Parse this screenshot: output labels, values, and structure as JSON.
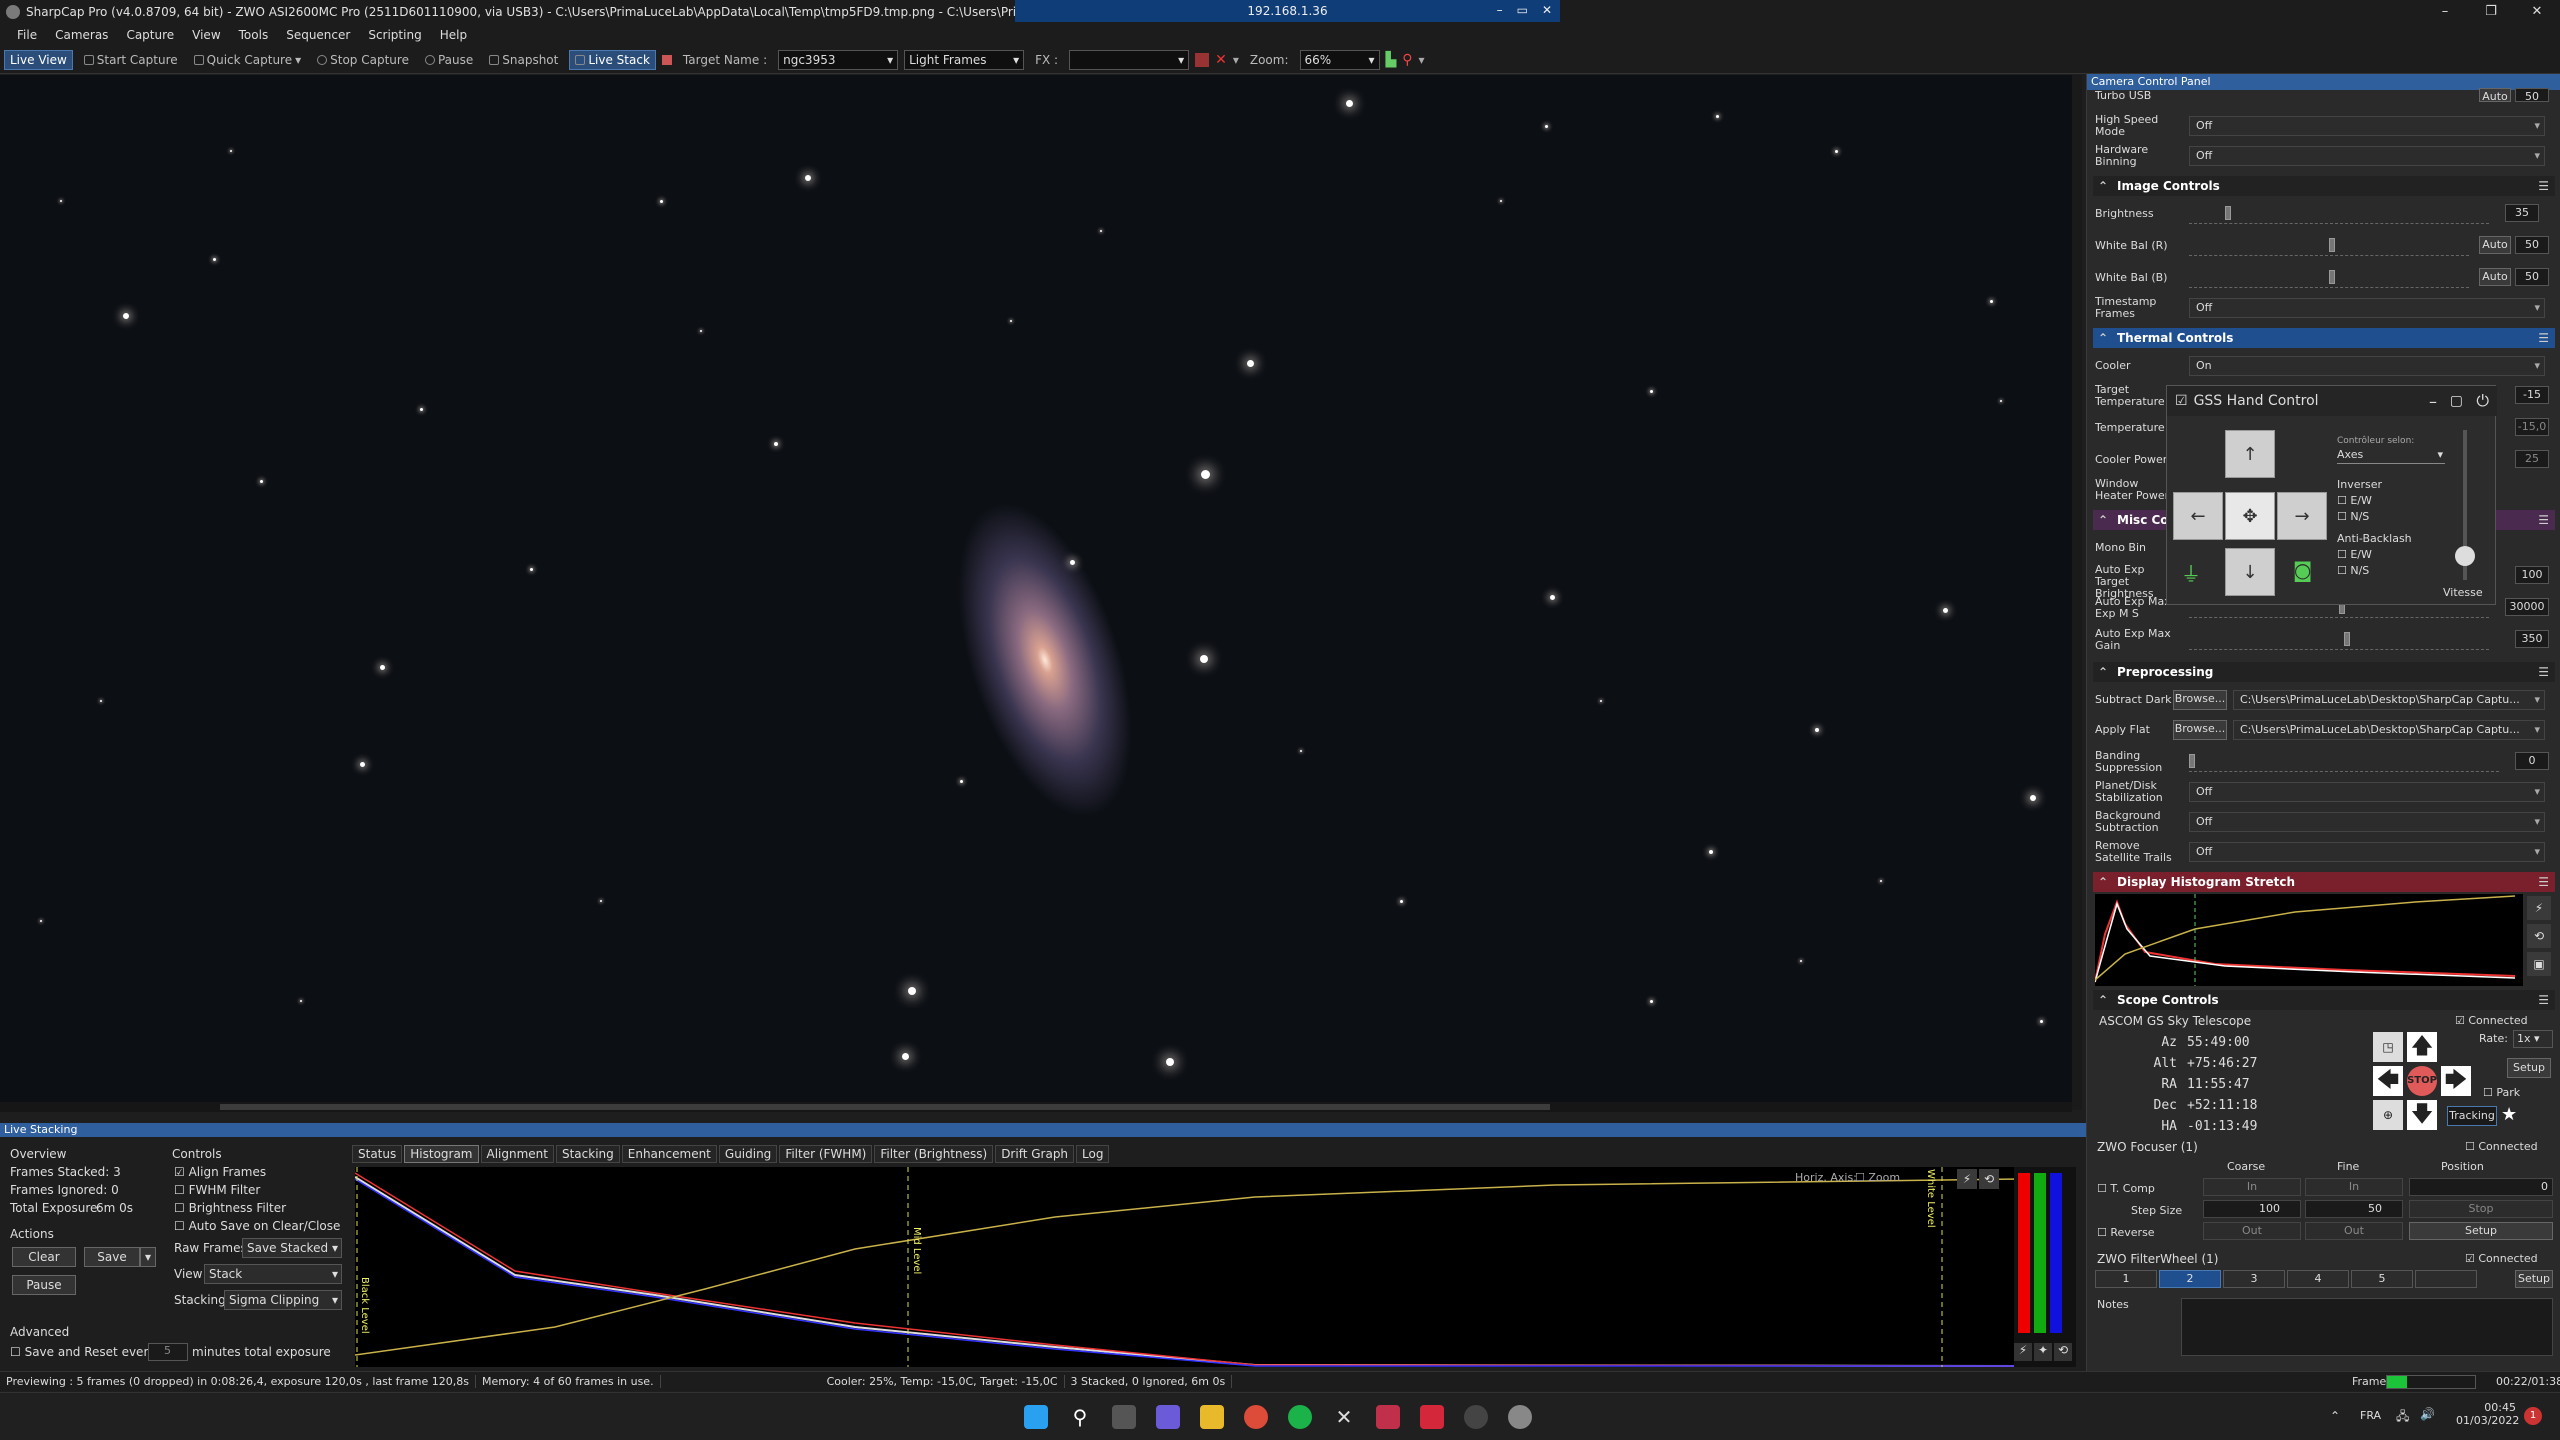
{
  "window": {
    "title": "SharpCap Pro (v4.0.8709, 64 bit) - ZWO ASI2600MC Pro (2511D601110900, via USB3) - C:\\Users\\PrimaLuceLab\\AppData\\Local\\Temp\\tmp5FD9.tmp.png - C:\\Users\\PrimaLuceLab\\Desk",
    "remote_ip": "192.168.1.36",
    "remote_btns": [
      "–",
      "▭",
      "✕"
    ],
    "controls": [
      "–",
      "❐",
      "✕"
    ]
  },
  "menu": [
    "File",
    "Cameras",
    "Capture",
    "View",
    "Tools",
    "Sequencer",
    "Scripting",
    "Help"
  ],
  "toolbar": {
    "live_view": "Live View",
    "start_capture": "Start Capture",
    "quick_capture": "Quick Capture",
    "stop_capture": "Stop Capture",
    "pause": "Pause",
    "snapshot": "Snapshot",
    "live_stack": "Live Stack",
    "target_label": "Target Name :",
    "target_value": "ngc3953",
    "frame_type": "Light Frames",
    "fx_label": "FX :",
    "fx_value": "",
    "zoom_label": "Zoom:",
    "zoom_value": "66%"
  },
  "camera_panel": {
    "title": "Camera Control Panel",
    "turbo_label": "Turbo USB",
    "turbo_value": "Auto",
    "turbo_num": "50",
    "high_speed_label": "High Speed Mode",
    "high_speed_value": "Off",
    "hw_binning_label": "Hardware Binning",
    "hw_binning_value": "Off",
    "image_controls": "Image Controls",
    "brightness_label": "Brightness",
    "brightness_value": "35",
    "brightness_level": 0.12,
    "wb_r_label": "White Bal (R)",
    "wb_r_auto": "Auto",
    "wb_r_value": "50",
    "wb_r_level": 0.5,
    "wb_b_label": "White Bal (B)",
    "wb_b_auto": "Auto",
    "wb_b_value": "50",
    "wb_b_level": 0.5,
    "timestamp_label": "Timestamp Frames",
    "timestamp_value": "Off",
    "thermal_controls": "Thermal Controls",
    "cooler_label": "Cooler",
    "cooler_value": "On",
    "target_temp_label": "Target Temperature",
    "target_temp_value": "-15",
    "temperature_label": "Temperature",
    "temperature_value": "-15,0",
    "cooler_power_label": "Cooler Power",
    "cooler_power_value": "25",
    "window_heater_label": "Window Heater Power",
    "misc_controls": "Misc Co",
    "mono_bin_label": "Mono Bin",
    "auto_exp_target_label": "Auto Exp Target Brightness",
    "auto_exp_target_value": "100",
    "auto_exp_max_ms_label": "Auto Exp Max Exp M S",
    "auto_exp_max_ms_value": "30000",
    "auto_exp_max_gain_label": "Auto Exp Max Gain",
    "auto_exp_max_gain_value": "350",
    "preprocessing": "Preprocessing",
    "subtract_dark_label": "Subtract Dark",
    "browse_label": "Browse...",
    "subtract_dark_path": "C:\\Users\\PrimaLuceLab\\Desktop\\SharpCap Captu...",
    "apply_flat_label": "Apply Flat",
    "apply_flat_path": "C:\\Users\\PrimaLuceLab\\Desktop\\SharpCap Captu...",
    "banding_label": "Banding Suppression",
    "banding_value": "0",
    "planet_label": "Planet/Disk Stabilization",
    "planet_value": "Off",
    "bg_sub_label": "Background Subtraction",
    "bg_sub_value": "Off",
    "sat_trails_label": "Remove Satellite Trails",
    "sat_trails_value": "Off",
    "display_histogram": "Display Histogram Stretch",
    "scope_controls": "Scope Controls",
    "scope_name": "ASCOM GS Sky Telescope",
    "connected": "Connected",
    "az_label": "Az",
    "az_value": "55:49:00",
    "alt_label": "Alt",
    "alt_value": "+75:46:27",
    "ra_label": "RA",
    "ra_value": "11:55:47",
    "dec_label": "Dec",
    "dec_value": "+52:11:18",
    "ha_label": "HA",
    "ha_value": "-01:13:49",
    "rate_label": "Rate:",
    "rate_value": "1x",
    "setup": "Setup",
    "park": "Park",
    "stop": "STOP",
    "tracking": "Tracking",
    "focuser_name": "ZWO Focuser (1)",
    "coarse": "Coarse",
    "fine": "Fine",
    "position": "Position",
    "tcomp": "T. Comp",
    "in_label": "In",
    "position_value": "0",
    "step_size": "Step Size",
    "coarse_step": "100",
    "fine_step": "50",
    "stop_btn": "Stop",
    "reverse": "Reverse",
    "out_label": "Out",
    "filterwheel_name": "ZWO FilterWheel (1)",
    "filters": [
      "1",
      "2",
      "3",
      "4",
      "5",
      ""
    ],
    "notes": "Notes"
  },
  "gss": {
    "title": "GSS Hand Control",
    "controller_label": "Contrôleur selon:",
    "controller_value": "Axes",
    "inverser": "Inverser",
    "ew": "E/W",
    "ns": "N/S",
    "anti_backlash": "Anti-Backlash",
    "vitesse": "Vitesse"
  },
  "live_stacking": {
    "title": "Live Stacking",
    "overview": "Overview",
    "frames_stacked": "Frames Stacked: 3",
    "frames_ignored": "Frames Ignored: 0",
    "total_exposure": "Total Exposure:",
    "total_exposure_value": "6m 0s",
    "actions": "Actions",
    "clear": "Clear",
    "save": "Save",
    "pause": "Pause",
    "advanced": "Advanced",
    "save_reset": "Save and Reset every",
    "save_reset_value": "5",
    "minutes_total": "minutes total exposure",
    "controls": "Controls",
    "align_frames": "Align Frames",
    "fwhm_filter": "FWHM Filter",
    "brightness_filter": "Brightness Filter",
    "auto_save": "Auto Save on Clear/Close",
    "raw_frames_label": "Raw Frames",
    "raw_frames_value": "Save Stacked",
    "view_label": "View",
    "view_value": "Stack",
    "stacking_label": "Stacking",
    "stacking_value": "Sigma Clipping",
    "tabs": [
      "Status",
      "Histogram",
      "Alignment",
      "Stacking",
      "Enhancement",
      "Guiding",
      "Filter (FWHM)",
      "Filter (Brightness)",
      "Drift Graph",
      "Log"
    ],
    "horiz_axis": "Horiz. Axis:",
    "zoom": "Zoom",
    "black_level": "Black Level",
    "mid_level": "Mid Level",
    "white_level": "White Level"
  },
  "status": {
    "preview": "Previewing : 5 frames (0 dropped) in 0:08:26,4, exposure 120,0s , last frame 120,8s",
    "memory": "Memory: 4 of 60 frames in use.",
    "cooler": "Cooler: 25%, Temp: -15,0C, Target: -15,0C",
    "stacked": "3 Stacked, 0 Ignored, 6m 0s",
    "frame_label": "Frame:",
    "frame_time": "00:22/01:38",
    "frame_progress": 0.23
  },
  "taskbar": {
    "lang": "FRA",
    "time": "00:45",
    "date": "01/03/2022"
  },
  "colors": {
    "accent_blue": "#2f5f9c",
    "thermal_blue": "#1f4f8f",
    "histo_red": "#7a1f2c",
    "stop_red": "#e05a5a"
  }
}
